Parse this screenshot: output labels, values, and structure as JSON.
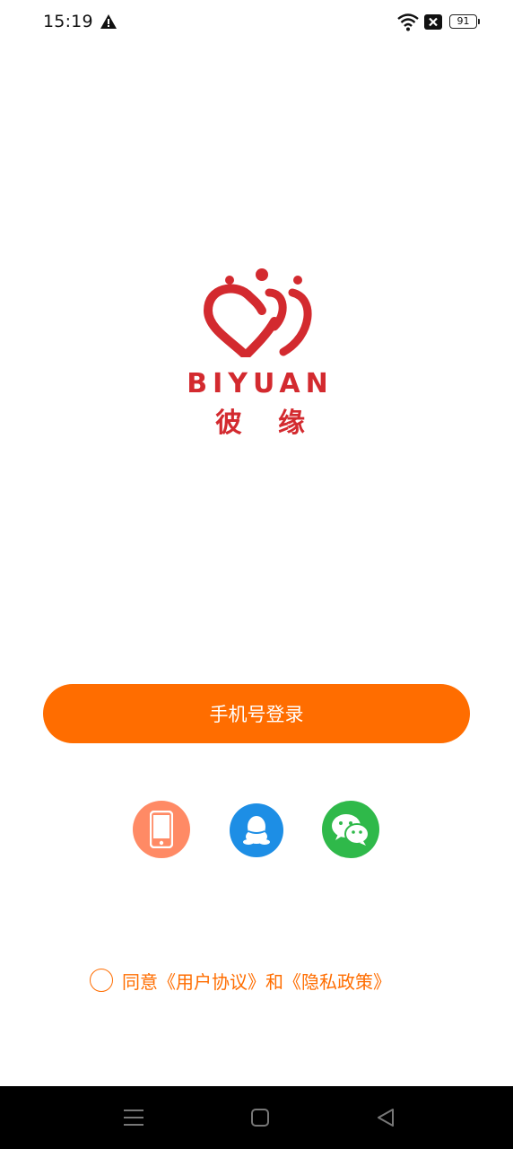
{
  "status_bar": {
    "time": "15:19",
    "battery": "91",
    "icons": [
      "warning-icon",
      "wifi-icon",
      "sim-x-icon",
      "battery-icon"
    ]
  },
  "logo": {
    "brand_en": "BIYUAN",
    "brand_cn": "彼缘",
    "color": "#d32a2f"
  },
  "login": {
    "phone_login_label": "手机号登录",
    "accent": "#ff6d00"
  },
  "social": {
    "buttons": [
      {
        "name": "phone",
        "icon": "phone-icon",
        "color": "#ff8a65"
      },
      {
        "name": "qq",
        "icon": "qq-penguin-icon",
        "color": "#1d8ee5"
      },
      {
        "name": "wechat",
        "icon": "wechat-icon",
        "color": "#2fb94a"
      }
    ]
  },
  "agreement": {
    "prefix": "同意",
    "user_agreement": "《用户协议》",
    "conjunction": "和",
    "privacy_policy": "《隐私政策》"
  },
  "nav": {
    "icons": [
      "menu-icon",
      "home-icon",
      "back-icon"
    ]
  }
}
